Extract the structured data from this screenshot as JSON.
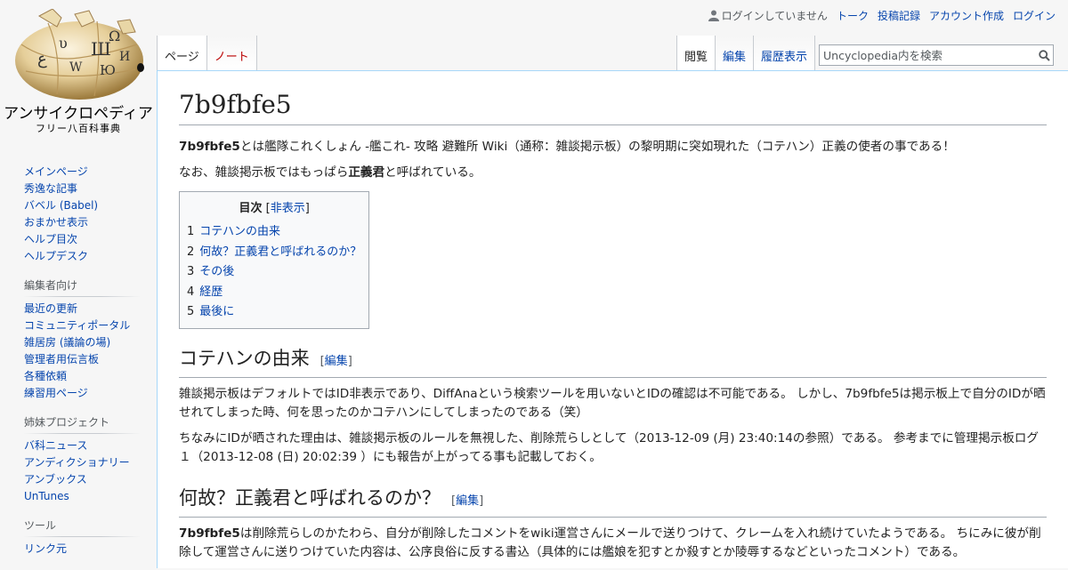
{
  "personal": {
    "anon_text": "ログインしていません",
    "links": [
      "トーク",
      "投稿記録",
      "アカウント作成",
      "ログイン"
    ]
  },
  "logo": {
    "title": "アンサイクロペディア",
    "subtitle": "フリー八百科事典"
  },
  "tabs": {
    "left": [
      {
        "label": "ページ",
        "state": "selected"
      },
      {
        "label": "ノート",
        "state": "new"
      }
    ],
    "right": [
      {
        "label": "閲覧",
        "state": "selected"
      },
      {
        "label": "編集",
        "state": "link"
      },
      {
        "label": "履歴表示",
        "state": "link"
      }
    ]
  },
  "search": {
    "placeholder": "Uncyclopedia内を検索",
    "icon": "search-icon"
  },
  "sidebar": {
    "navigation": [
      "メインページ",
      "秀逸な記事",
      "バベル (Babel)",
      "おまかせ表示",
      "ヘルプ目次",
      "ヘルプデスク"
    ],
    "editors": {
      "heading": "編集者向け",
      "items": [
        "最近の更新",
        "コミュニティポータル",
        "雑居房 (議論の場)",
        "管理者用伝言板",
        "各種依頼",
        "練習用ページ"
      ]
    },
    "sister": {
      "heading": "姉妹プロジェクト",
      "items": [
        "バ科ニュース",
        "アンディクショナリー",
        "アンブックス",
        "UnTunes"
      ]
    },
    "tools": {
      "heading": "ツール",
      "items": [
        "リンク元"
      ]
    }
  },
  "article": {
    "title": "7b9fbfe5",
    "intro1": {
      "bold": "7b9fbfe5",
      "text": "とは艦隊これくしょん -艦これ- 攻略 避難所 Wiki（通称：雑談掲示板）の黎明期に突如現れた（コテハン）正義の使者の事である！"
    },
    "intro2": {
      "before": "なお、雑談掲示板ではもっぱら",
      "bold": "正義君",
      "after": "と呼ばれている。"
    },
    "toc": {
      "title": "目次",
      "toggle_open": "[",
      "toggle_label": "非表示",
      "toggle_close": "]",
      "items": [
        {
          "number": "1",
          "label": "コテハンの由来"
        },
        {
          "number": "2",
          "label": "何故？正義君と呼ばれるのか？"
        },
        {
          "number": "3",
          "label": "その後"
        },
        {
          "number": "4",
          "label": "経歴"
        },
        {
          "number": "5",
          "label": "最後に"
        }
      ]
    },
    "edit_open": "[",
    "edit_label": "編集",
    "edit_close": "]",
    "sections": [
      {
        "heading": "コテハンの由来",
        "paragraphs": [
          "雑談掲示板はデフォルトではID非表示であり、DiffAnaという検索ツールを用いないとIDの確認は不可能である。 しかし、7b9fbfe5は掲示板上で自分のIDが晒せれてしまった時、何を思ったのかコテハンにしてしまったのである（笑）",
          "ちなみにIDが晒された理由は、雑談掲示板のルールを無視した、削除荒らしとして（2013-12-09 (月) 23:40:14の参照）である。 参考までに管理掲示板ログ１（2013-12-08 (日) 20:02:39 ）にも報告が上がってる事も記載しておく。"
        ]
      },
      {
        "heading": "何故？正義君と呼ばれるのか？",
        "p1_bold": "7b9fbfe5",
        "p1_text": "は削除荒らしのかたわら、自分が削除したコメントをwiki運営さんにメールで送りつけて、クレームを入れ続けていたようである。 ちにみに彼が削除して運営さんに送りつけていた内容は、公序良俗に反する書込（具体的には艦娘を犯すとか殺すとか陵辱するなどといったコメント）である。"
      }
    ]
  },
  "colors": {
    "link": "#0645ad",
    "new_link": "#ba0000",
    "border": "#a7d7f9"
  }
}
